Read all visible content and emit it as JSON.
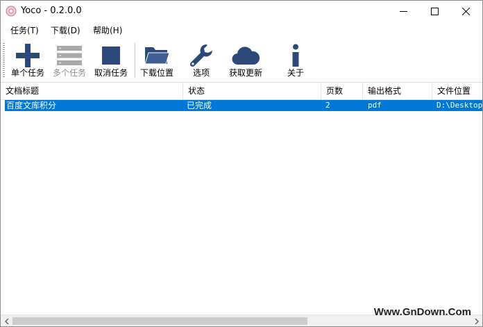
{
  "window": {
    "title": "Yoco - 0.2.0.0",
    "minimize_icon": "minimize-icon",
    "maximize_icon": "maximize-icon",
    "close_icon": "close-icon"
  },
  "menu": {
    "items": [
      {
        "label": "任务(T)"
      },
      {
        "label": "下载(D)"
      },
      {
        "label": "帮助(H)"
      }
    ]
  },
  "toolbar": {
    "accent_color": "#2b4a7a",
    "disabled_color": "#a8a8a8",
    "buttons": [
      {
        "label": "单个任务",
        "icon": "plus-icon",
        "enabled": true
      },
      {
        "label": "多个任务",
        "icon": "list-icon",
        "enabled": false
      },
      {
        "label": "取消任务",
        "icon": "stop-icon",
        "enabled": true
      },
      {
        "label": "下载位置",
        "icon": "folder-icon",
        "enabled": true
      },
      {
        "label": "选项",
        "icon": "wrench-icon",
        "enabled": true
      },
      {
        "label": "获取更新",
        "icon": "cloud-icon",
        "enabled": true
      },
      {
        "label": "关于",
        "icon": "info-icon",
        "enabled": true
      }
    ]
  },
  "table": {
    "columns": [
      "文档标题",
      "状态",
      "页数",
      "输出格式",
      "文件位置"
    ],
    "rows": [
      {
        "title": "百度文库积分",
        "status": "已完成",
        "pages": "2",
        "format": "pdf",
        "location": "D:\\Desktop\\"
      }
    ],
    "selection_color": "#0078d7"
  },
  "watermark": "Www.GnDown.Com"
}
